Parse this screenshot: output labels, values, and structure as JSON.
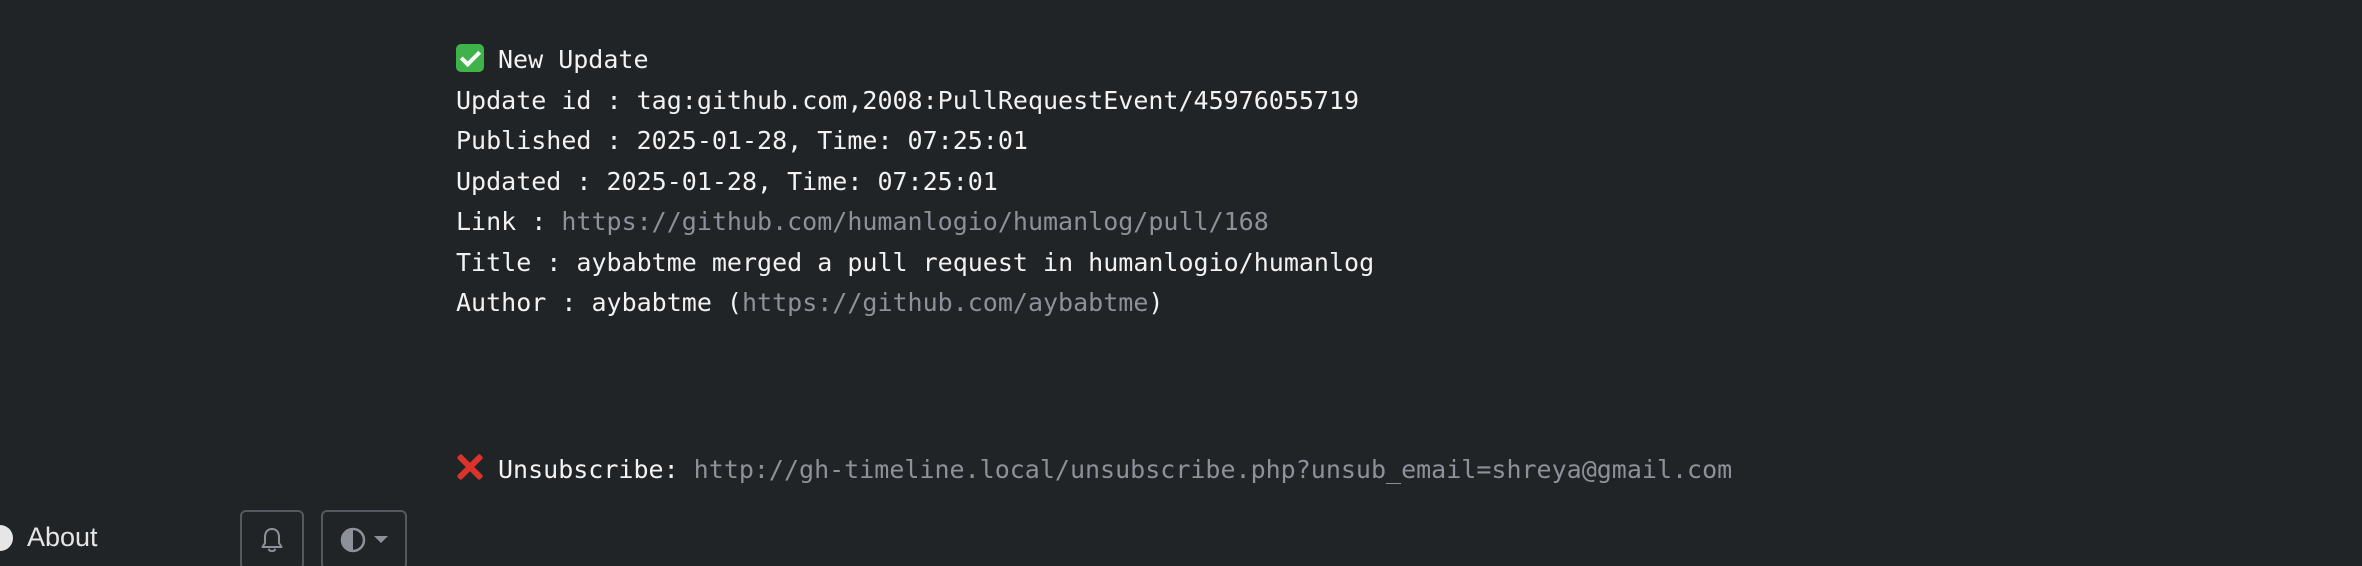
{
  "email": {
    "header": "New Update",
    "lines": [
      {
        "label": "Update id : ",
        "value": "tag:github.com,2008:PullRequestEvent/45976055719"
      },
      {
        "label": "Published : ",
        "value": "2025-01-28, Time: 07:25:01"
      },
      {
        "label": "Updated : ",
        "value": "2025-01-28, Time: 07:25:01"
      },
      {
        "label": "Link : ",
        "link": "https://github.com/humanlogio/humanlog/pull/168"
      },
      {
        "label": "Title : ",
        "value": "aybabtme merged a pull request in humanlogio/humanlog"
      },
      {
        "label": "Author : ",
        "value": "aybabtme (",
        "link": "https://github.com/aybabtme",
        "suffix": ")"
      }
    ],
    "unsubscribe_label": "Unsubscribe: ",
    "unsubscribe_link": "http://gh-timeline.local/unsubscribe.php?unsub_email=shreya@gmail.com"
  },
  "footer": {
    "about_label": "About",
    "icons": {
      "notifications": "bell-icon",
      "theme": "contrast-icon"
    }
  },
  "colors": {
    "background": "#212427",
    "text": "#f2f2f2",
    "link": "#8d9199",
    "check": "#3fb34a",
    "cross": "#d9332b"
  }
}
